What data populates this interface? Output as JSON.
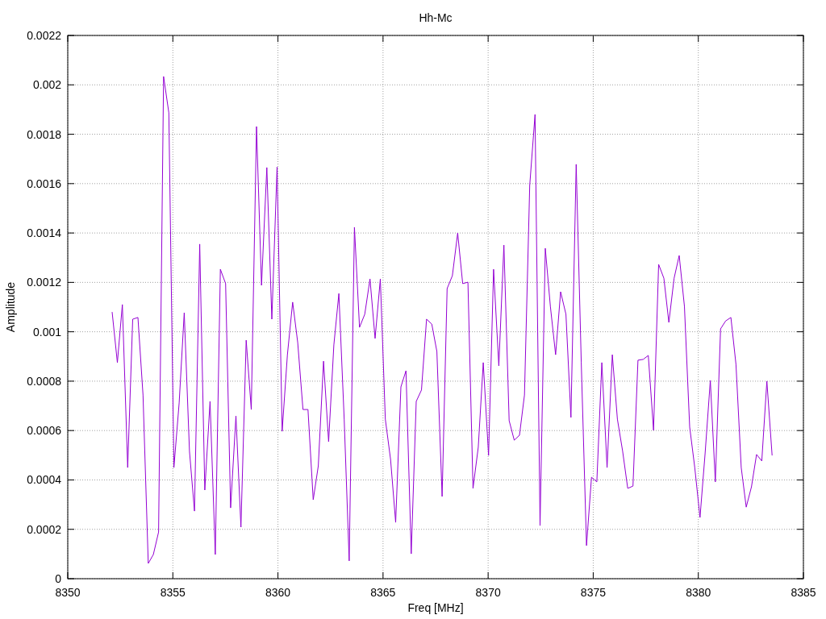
{
  "chart": {
    "chart_data": {
      "type": "line",
      "title": "Hh-Mc",
      "xlabel": "Freq [MHz]",
      "ylabel": "Amplitude",
      "grid": true,
      "xlim": [
        8350,
        8385
      ],
      "ylim": [
        0,
        0.0022
      ],
      "xticks": [
        8350,
        8355,
        8360,
        8365,
        8370,
        8375,
        8380,
        8385
      ],
      "yticks": [
        0,
        0.0002,
        0.0004,
        0.0006,
        0.0008,
        0.001,
        0.0012,
        0.0014,
        0.0016,
        0.0018,
        0.002,
        0.0022
      ],
      "x": [
        8352.11,
        8352.36,
        8352.6,
        8352.85,
        8353.09,
        8353.34,
        8353.58,
        8353.83,
        8354.07,
        8354.32,
        8354.56,
        8354.81,
        8355.05,
        8355.3,
        8355.54,
        8355.79,
        8356.03,
        8356.28,
        8356.52,
        8356.77,
        8357.02,
        8357.26,
        8357.51,
        8357.75,
        8358.0,
        8358.24,
        8358.49,
        8358.73,
        8358.98,
        8359.22,
        8359.47,
        8359.71,
        8359.96,
        8360.2,
        8360.45,
        8360.7,
        8360.94,
        8361.19,
        8361.43,
        8361.68,
        8361.92,
        8362.17,
        8362.41,
        8362.66,
        8362.9,
        8363.15,
        8363.39,
        8363.64,
        8363.88,
        8364.13,
        8364.38,
        8364.62,
        8364.87,
        8365.11,
        8365.36,
        8365.6,
        8365.85,
        8366.09,
        8366.34,
        8366.58,
        8366.83,
        8367.07,
        8367.32,
        8367.56,
        8367.81,
        8368.05,
        8368.3,
        8368.55,
        8368.79,
        8369.04,
        8369.28,
        8369.53,
        8369.77,
        8370.02,
        8370.26,
        8370.51,
        8370.75,
        8371.0,
        8371.24,
        8371.49,
        8371.73,
        8371.98,
        8372.23,
        8372.47,
        8372.72,
        8372.96,
        8373.21,
        8373.45,
        8373.7,
        8373.94,
        8374.19,
        8374.43,
        8374.68,
        8374.92,
        8375.17,
        8375.41,
        8375.66,
        8375.91,
        8376.15,
        8376.4,
        8376.64,
        8376.89,
        8377.13,
        8377.38,
        8377.62,
        8377.87,
        8378.11,
        8378.36,
        8378.6,
        8378.85,
        8379.09,
        8379.34,
        8379.59,
        8379.83,
        8380.08,
        8380.32,
        8380.57,
        8380.81,
        8381.06,
        8381.3,
        8381.55,
        8381.79,
        8382.04,
        8382.28,
        8382.53,
        8382.77,
        8383.02,
        8383.26,
        8383.51
      ],
      "series": [
        {
          "color": "#9400d3",
          "values": [
            0.00108,
            0.000875,
            0.00111,
            0.00045,
            0.001051,
            0.001058,
            0.000744,
            6.2e-05,
            9.8e-05,
            0.000189,
            0.002034,
            0.001887,
            0.00045,
            0.000712,
            0.001077,
            0.000516,
            0.000274,
            0.001355,
            0.000359,
            0.000718,
            9.8e-05,
            0.001253,
            0.001195,
            0.000287,
            0.000659,
            0.000209,
            0.000966,
            0.000685,
            0.001831,
            0.001188,
            0.001665,
            0.001051,
            0.001668,
            0.000597,
            0.000907,
            0.00112,
            0.000956,
            0.000685,
            0.000685,
            0.00032,
            0.000457,
            0.000881,
            0.000555,
            0.000947,
            0.001155,
            0.000646,
            7.2e-05,
            0.001423,
            0.001018,
            0.001071,
            0.001214,
            0.000973,
            0.001214,
            0.000646,
            0.000483,
            0.000228,
            0.000777,
            0.000842,
            0.000101,
            0.000718,
            0.000764,
            0.001051,
            0.001031,
            0.00092,
            0.000333,
            0.001175,
            0.001227,
            0.0014,
            0.001195,
            0.001201,
            0.000366,
            0.000532,
            0.000875,
            0.000499,
            0.001253,
            0.000862,
            0.001351,
            0.00064,
            0.000561,
            0.000581,
            0.000744,
            0.001593,
            0.00188,
            0.000215,
            0.001338,
            0.001103,
            0.000907,
            0.001162,
            0.001071,
            0.000653,
            0.001678,
            0.000875,
            0.000134,
            0.000411,
            0.000392,
            0.000875,
            0.00045,
            0.000907,
            0.000646,
            0.000516,
            0.000366,
            0.000375,
            0.000885,
            0.000888,
            0.000904,
            0.000601,
            0.001273,
            0.001217,
            0.001038,
            0.001217,
            0.001309,
            0.001103,
            0.000614,
            0.00045,
            0.000248,
            0.000506,
            0.000803,
            0.000392,
            0.001012,
            0.001044,
            0.001058,
            0.000868,
            0.00045,
            0.00029,
            0.000372,
            0.000503,
            0.000477,
            0.0008,
            0.000499
          ]
        }
      ]
    }
  }
}
